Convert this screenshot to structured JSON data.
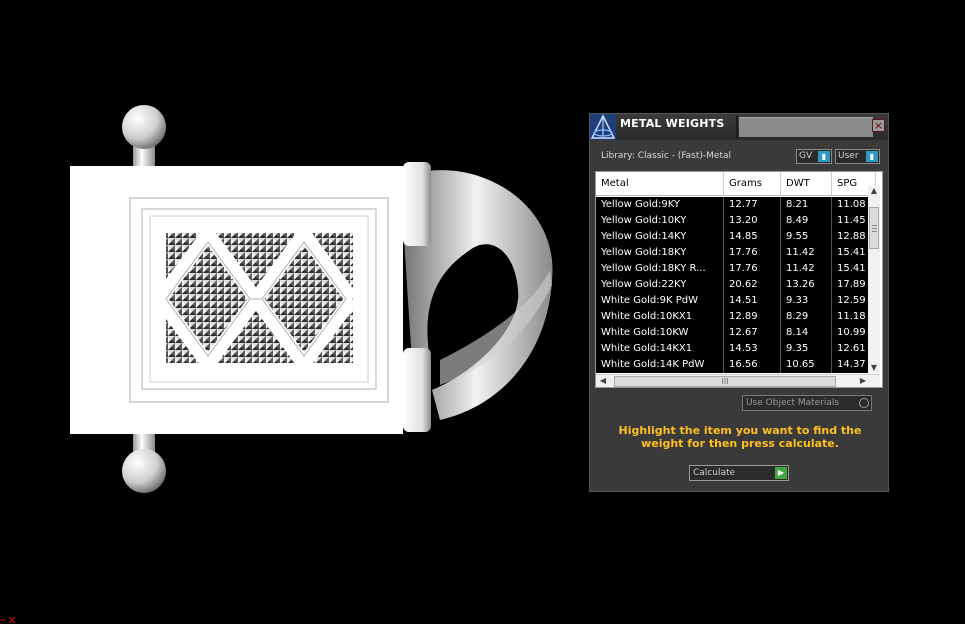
{
  "panel": {
    "title": "METAL WEIGHTS",
    "close_icon": "close-icon",
    "library_label": "Library: Classic - (Fast)-Metal",
    "gv_combo": "GV",
    "user_combo": "User",
    "use_object_materials": "Use Object Materials",
    "instructions": "Highlight the item you want to find the weight for then press calculate.",
    "calculate_label": "Calculate",
    "hscroll_grip": "III"
  },
  "table": {
    "columns": [
      "Metal",
      "Grams",
      "DWT",
      "SPG"
    ],
    "rows": [
      [
        "Yellow Gold:9KY",
        "12.77",
        "8.21",
        "11.08"
      ],
      [
        "Yellow Gold:10KY",
        "13.20",
        "8.49",
        "11.45"
      ],
      [
        "Yellow Gold:14KY",
        "14.85",
        "9.55",
        "12.88"
      ],
      [
        "Yellow Gold:18KY",
        "17.76",
        "11.42",
        "15.41"
      ],
      [
        "Yellow Gold:18KY R...",
        "17.76",
        "11.42",
        "15.41"
      ],
      [
        "Yellow Gold:22KY",
        "20.62",
        "13.26",
        "17.89"
      ],
      [
        "White Gold:9K PdW",
        "14.51",
        "9.33",
        "12.59"
      ],
      [
        "White Gold:10KX1",
        "12.89",
        "8.29",
        "11.18"
      ],
      [
        "White Gold:10KW",
        "12.67",
        "8.14",
        "10.99"
      ],
      [
        "White Gold:14KX1",
        "14.53",
        "9.35",
        "12.61"
      ],
      [
        "White Gold:14K PdW",
        "16.56",
        "10.65",
        "14.37"
      ]
    ]
  },
  "colors": {
    "accent": "#2e9ac4",
    "instruction_text": "#ffc020",
    "go_button": "#3fa83f"
  }
}
